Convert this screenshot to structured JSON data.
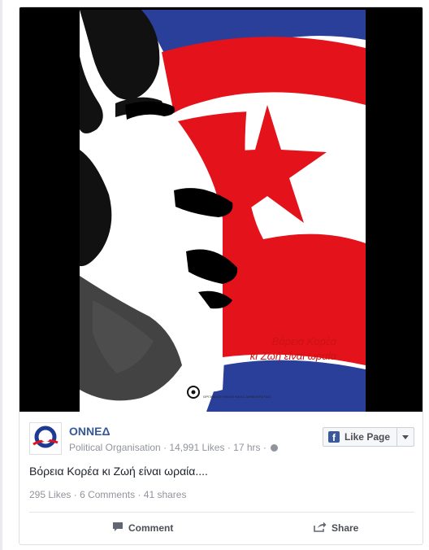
{
  "poster": {
    "slogan_line1": "Βόρεια Κορέα",
    "slogan_line2": "κι Ζωή είναι ωραία",
    "org_caption": "ΟΡΓΑΝΩΣΗ ΝΕΩΝ ΝΕΑΣ ΔΗΜΟΚΡΑΤΙΑΣ"
  },
  "page": {
    "name": "ΟΝΝΕΔ",
    "category": "Political Organisation",
    "separator": "·",
    "likes": "14,991 Likes",
    "time": "17 hrs",
    "logo_icon": "onned-logo-icon",
    "globe_icon": "globe-icon"
  },
  "like_page_button": {
    "label": "Like Page",
    "icon": "facebook-icon"
  },
  "post": {
    "text": "Βόρεια Κορέα κι Ζωή είναι ωραία...."
  },
  "stats": {
    "likes": "295 Likes",
    "comments": "6 Comments",
    "shares": "41 shares"
  },
  "actions": {
    "comment": "Comment",
    "share": "Share"
  },
  "colors": {
    "link_blue": "#365899",
    "flag_red": "#e3121b",
    "flag_blue": "#1f3a93",
    "facebook_blue": "#3b5998",
    "meta_gray": "#90949c"
  }
}
